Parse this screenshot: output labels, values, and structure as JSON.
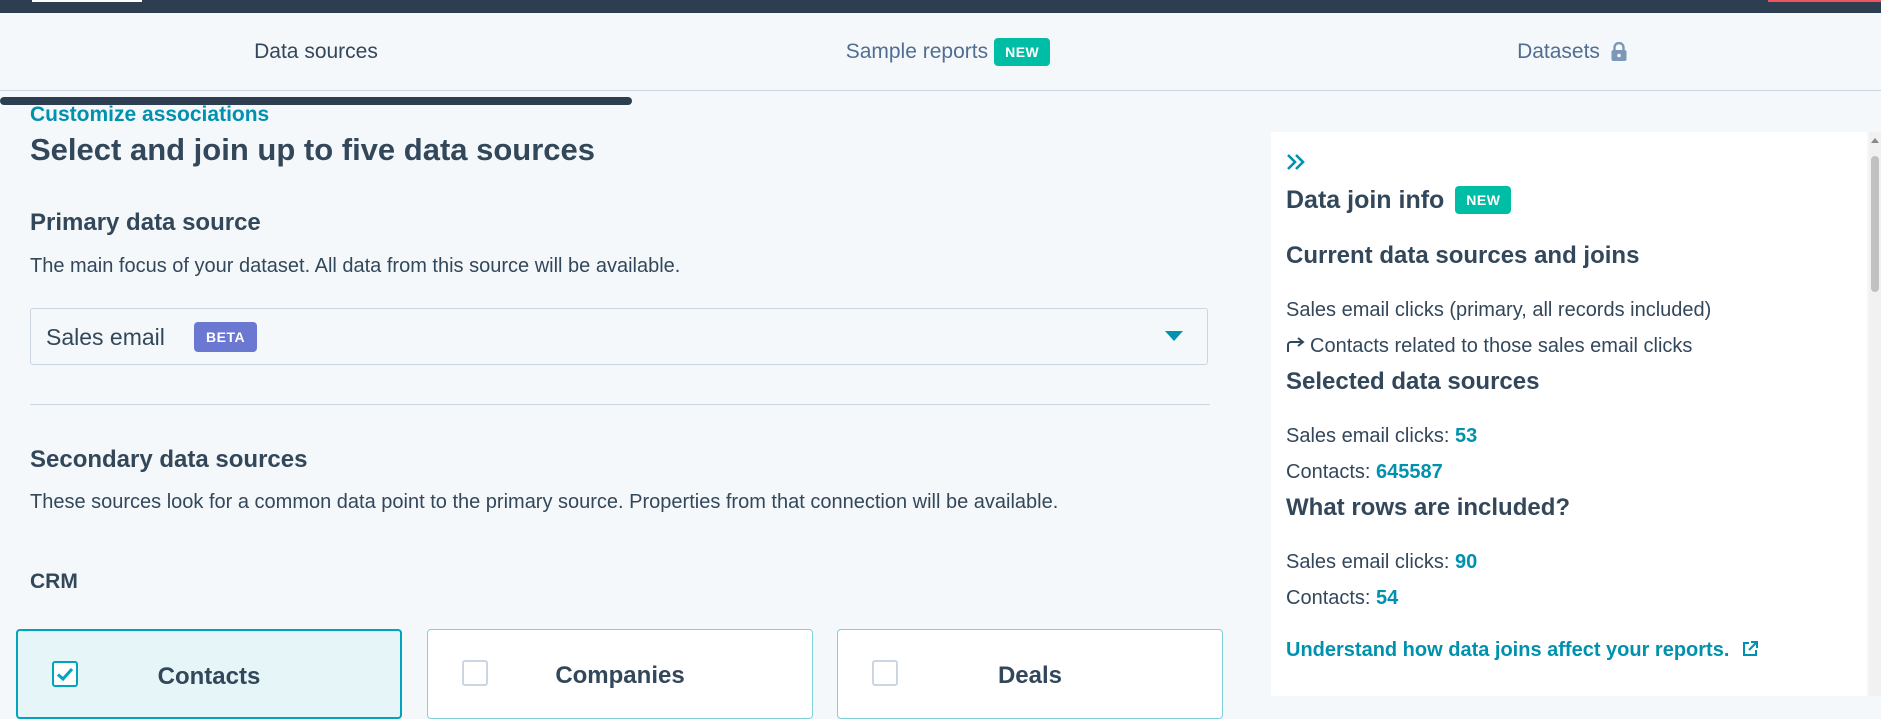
{
  "tabs": {
    "data_sources": "Data sources",
    "sample_reports": "Sample reports",
    "sample_reports_badge": "NEW",
    "datasets": "Datasets"
  },
  "main": {
    "customize_link": "Customize associations",
    "title": "Select and join up to five data sources",
    "primary": {
      "heading": "Primary data source",
      "description": "The main focus of your dataset. All data from this source will be available.",
      "selected_value": "Sales email",
      "selected_badge": "BETA"
    },
    "secondary": {
      "heading": "Secondary data sources",
      "description": "These sources look for a common data point to the primary source. Properties from that connection will be available.",
      "group_label": "CRM",
      "cards": [
        {
          "label": "Contacts",
          "checked": true
        },
        {
          "label": "Companies",
          "checked": false
        },
        {
          "label": "Deals",
          "checked": false
        }
      ]
    }
  },
  "panel": {
    "title": "Data join info",
    "title_badge": "NEW",
    "current_heading": "Current data sources and joins",
    "current_line1": "Sales email clicks (primary, all records included)",
    "current_line2": "Contacts related to those sales email clicks",
    "selected_heading": "Selected data sources",
    "selected_rows": [
      {
        "label": "Sales email clicks:",
        "value": "53"
      },
      {
        "label": "Contacts:",
        "value": "645587"
      }
    ],
    "included_heading": "What rows are included?",
    "included_rows": [
      {
        "label": "Sales email clicks:",
        "value": "90"
      },
      {
        "label": "Contacts:",
        "value": "54"
      }
    ],
    "footer_link": "Understand how data joins affect your reports."
  },
  "colors": {
    "accent": "#0091ae",
    "badge_new": "#00bda5",
    "badge_beta": "#6a78d1",
    "text": "#33475b",
    "topbar": "#2d3e50"
  }
}
